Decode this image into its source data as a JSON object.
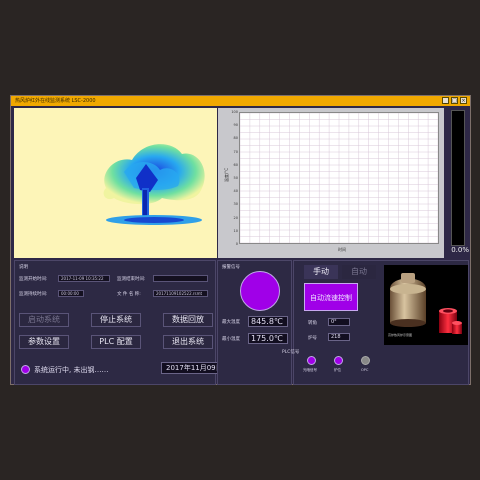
{
  "window": {
    "title": "热风炉红外在线监测系统  LSC-2000",
    "minimize": "_",
    "maximize": "□",
    "close": "×"
  },
  "chart": {
    "ylabel": "温度/°C",
    "xlabel": "时间",
    "yticks": [
      "100",
      "90",
      "80",
      "70",
      "60",
      "50",
      "40",
      "30",
      "20",
      "10",
      "0"
    ]
  },
  "gauge": {
    "percent": "0.0%"
  },
  "info": {
    "section_label": "说明",
    "start_time_label": "监测开始时间:",
    "start_time_value": "2017-11-09 10:35:22",
    "end_time_label": "监测结束时间:",
    "end_time_value": "",
    "duration_label": "监测持续时间:",
    "duration_value": "00:00:00",
    "file_label": "文 件 名 称:",
    "file_value": "20171109102522.rsmt"
  },
  "buttons": {
    "start": "启动系统",
    "stop": "停止系统",
    "playback": "数据回放",
    "params": "参数设置",
    "plc": "PLC 配置",
    "exit": "退出系统"
  },
  "status": {
    "message": "系统运行中, 未出钢……",
    "datetime": "2017年11月09日 11:38:10"
  },
  "alarm": {
    "label": "报警信号",
    "max_temp_label": "最大温度",
    "max_temp_value": "845.8℃",
    "min_temp_label": "最小温度",
    "min_temp_value": "175.0℃"
  },
  "control": {
    "manual_tab": "手动",
    "auto_tab": "自动",
    "auto_control_btn": "自动流速控制",
    "angle_label": "转角",
    "angle_value": "0°",
    "furnace_label": "炉号",
    "furnace_value": "218",
    "plc_signal_label": "PLC信号",
    "ind1": "光暗信号",
    "ind2": "炉位",
    "ind3": "OPC",
    "image_caption": "高炉热风炉示意图"
  },
  "colors": {
    "accent": "#f0a800",
    "purple": "#a000e8"
  }
}
